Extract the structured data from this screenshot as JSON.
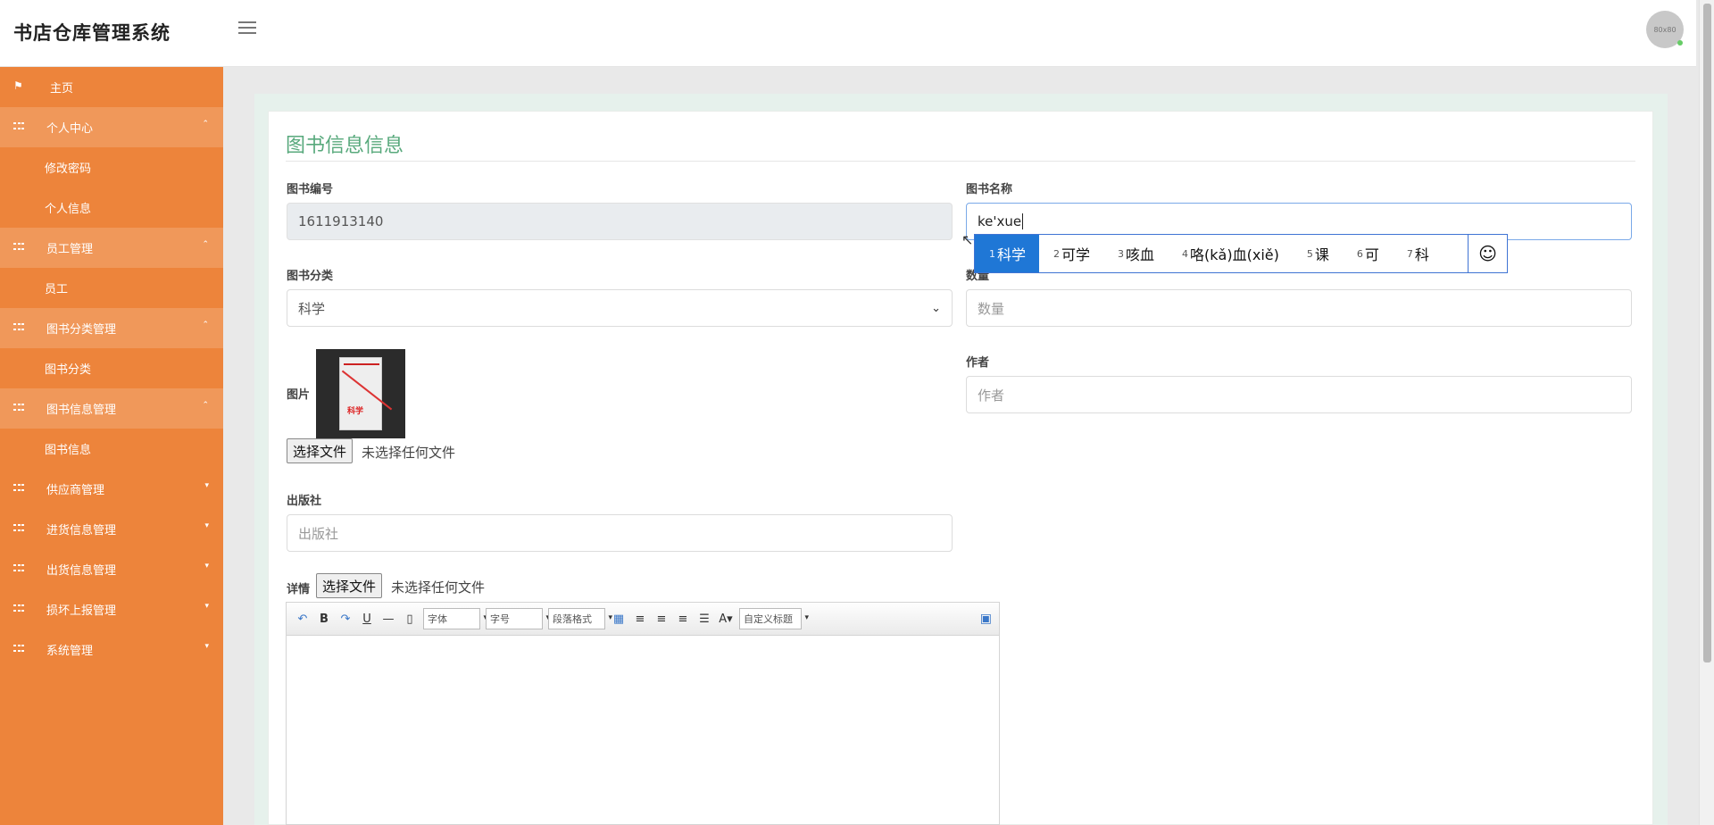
{
  "app": {
    "title": "书店仓库管理系统",
    "avatar_text": "80x80"
  },
  "sidebar": {
    "items": [
      {
        "label": "主页"
      },
      {
        "label": "个人中心"
      },
      {
        "label": "修改密码"
      },
      {
        "label": "个人信息"
      },
      {
        "label": "员工管理"
      },
      {
        "label": "员工"
      },
      {
        "label": "图书分类管理"
      },
      {
        "label": "图书分类"
      },
      {
        "label": "图书信息管理"
      },
      {
        "label": "图书信息"
      },
      {
        "label": "供应商管理"
      },
      {
        "label": "进货信息管理"
      },
      {
        "label": "出货信息管理"
      },
      {
        "label": "损坏上报管理"
      },
      {
        "label": "系统管理"
      }
    ]
  },
  "form": {
    "title": "图书信息信息",
    "book_no": {
      "label": "图书编号",
      "value": "1611913140"
    },
    "book_name": {
      "label": "图书名称",
      "value": "ke'xue"
    },
    "category": {
      "label": "图书分类",
      "value": "科学"
    },
    "quantity": {
      "label": "数量",
      "placeholder": "数量"
    },
    "image": {
      "label": "图片"
    },
    "file_button": "选择文件",
    "no_file": "未选择任何文件",
    "author": {
      "label": "作者",
      "placeholder": "作者"
    },
    "publisher": {
      "label": "出版社",
      "placeholder": "出版社"
    },
    "details": {
      "label": "详情"
    }
  },
  "ime": {
    "candidates": [
      {
        "n": "1",
        "text": "科学"
      },
      {
        "n": "2",
        "text": "可学"
      },
      {
        "n": "3",
        "text": "咳血"
      },
      {
        "n": "4",
        "text": "咯(kǎ)血(xiě)"
      },
      {
        "n": "5",
        "text": "课"
      },
      {
        "n": "6",
        "text": "可"
      },
      {
        "n": "7",
        "text": "科"
      }
    ],
    "emoji": "☺"
  },
  "editor": {
    "font_label": "字体",
    "size_label": "字号",
    "para_label": "段落格式",
    "custom_label": "自定义标题"
  },
  "colors": {
    "sidebar": "#ed843b",
    "sidebar_open": "#f0985a",
    "title": "#58a97c",
    "ime_selected": "#1f77d6"
  }
}
